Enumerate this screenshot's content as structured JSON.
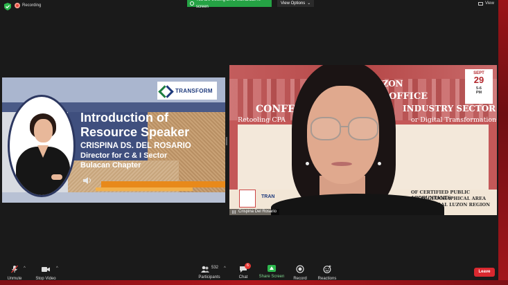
{
  "top_bar": {
    "recording_label": "Recording",
    "viewing_banner": "You are viewing LITO MENDOZA's screen",
    "view_options_label": "View Options",
    "view_button_label": "View"
  },
  "shared_slide": {
    "logo_text": "TRANSFORM",
    "title_line1": "Introduction of",
    "title_line2": "Resource Speaker",
    "speaker_name": "CRISPINA DS. DEL ROSARIO",
    "speaker_role": "Director for C & I Sector",
    "speaker_chapter": "Bulacan Chapter"
  },
  "video": {
    "participant_name": "Crispina Del Rosario",
    "backdrop": {
      "date_month": "SEPT",
      "date_day": "29",
      "date_time": "5-6",
      "date_ampm": "PM",
      "frag_uzon": "UZON",
      "frag_office": "OFFICE",
      "frag_conf": "CONFER",
      "frag_sector": "INDUSTRY SECTOR",
      "frag_retool": "Retooling CPA",
      "frag_digital": "or Digital Transformation",
      "org_line1": "OF CERTIFIED PUBLIC ACCOUNTANTS",
      "org_line2": "UZON GEOGRAPHICAL AREA OFFICE",
      "org_line3": "CPA CENTRAL LUZON REGION",
      "logo_frag": "TRAN"
    }
  },
  "toolbar": {
    "unmute_label": "Unmute",
    "stop_video_label": "Stop Video",
    "participants_label": "Participants",
    "participants_count": "532",
    "chat_label": "Chat",
    "chat_badge": "6",
    "share_screen_label": "Share Screen",
    "record_label": "Record",
    "reactions_label": "Reactions",
    "leave_label": "Leave"
  },
  "colors": {
    "share_green": "#2db84d",
    "leave_red": "#d9282f",
    "banner_green": "#25a244",
    "slide_navy": "#3f4f7e",
    "slide_orange": "#e8891a"
  },
  "icons": [
    "shield-icon",
    "record-dot-icon",
    "view-grid-icon",
    "speaker-icon",
    "mic-muted-icon",
    "video-camera-icon",
    "participants-icon",
    "chat-icon",
    "share-screen-icon",
    "record-icon",
    "reactions-icon"
  ]
}
